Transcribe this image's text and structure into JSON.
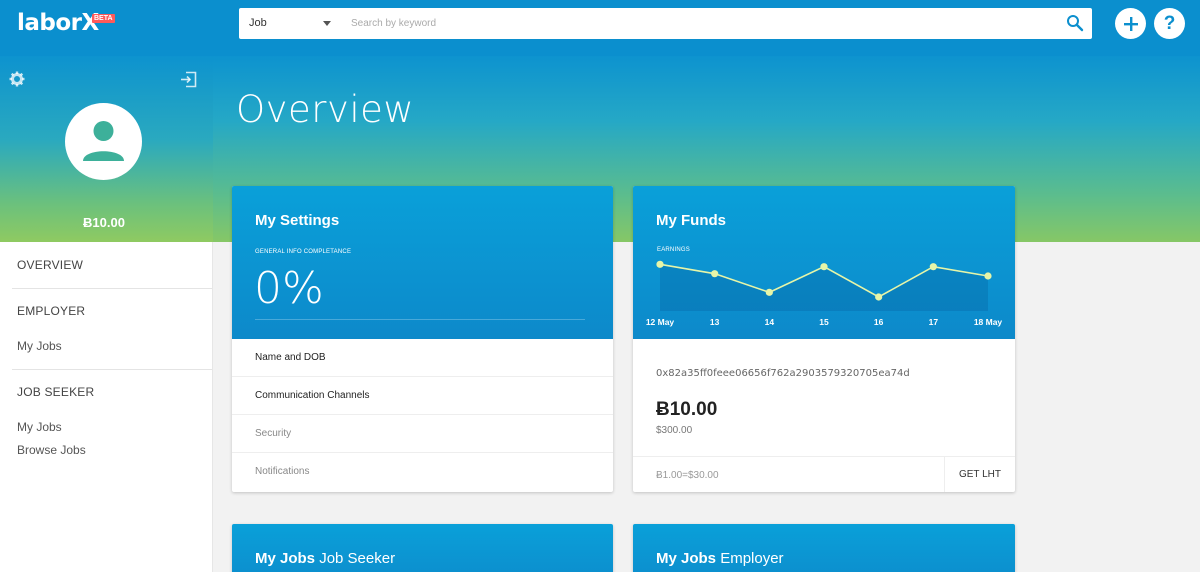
{
  "header": {
    "logo": "laborX",
    "beta_badge": "BETA",
    "search_select": "Job",
    "search_placeholder": "Search by keyword"
  },
  "sidebar": {
    "balance": "Ƀ10.00",
    "sections": [
      {
        "label": "OVERVIEW",
        "links": []
      },
      {
        "label": "EMPLOYER",
        "links": [
          "My Jobs"
        ]
      },
      {
        "label": "JOB SEEKER",
        "links": [
          "My Jobs",
          "Browse Jobs"
        ]
      }
    ]
  },
  "main": {
    "title": "Overview",
    "settings": {
      "title": "My Settings",
      "completion_label": "GENERAL INFO COMPLETANCE",
      "completion_value": "0%",
      "rows": [
        "Name and DOB",
        "Communication Channels",
        "Security",
        "Notifications"
      ]
    },
    "funds": {
      "title": "My Funds",
      "address": "0x82a35ff0feee06656f762a2903579320705ea74d",
      "amount": "Ƀ10.00",
      "usd": "$300.00",
      "rate": "Ƀ1.00=$30.00",
      "get_button": "GET LHT"
    },
    "jobs_seeker": {
      "title_bold": "My Jobs",
      "title_light": "Job Seeker"
    },
    "jobs_employer": {
      "title_bold": "My Jobs",
      "title_light": "Employer"
    }
  },
  "chart_data": {
    "type": "line",
    "title": "EARNINGS",
    "x": [
      "12 May",
      "13",
      "14",
      "15",
      "16",
      "17",
      "18 May"
    ],
    "values": [
      10,
      8,
      4,
      9.5,
      3,
      9.5,
      7.5
    ],
    "ylim": [
      0,
      15
    ],
    "grid": false,
    "legend": "none"
  },
  "colors": {
    "brand_blue": "#0b8fce",
    "hero_green": "#86c766",
    "chart_point": "#e6f5a8"
  }
}
